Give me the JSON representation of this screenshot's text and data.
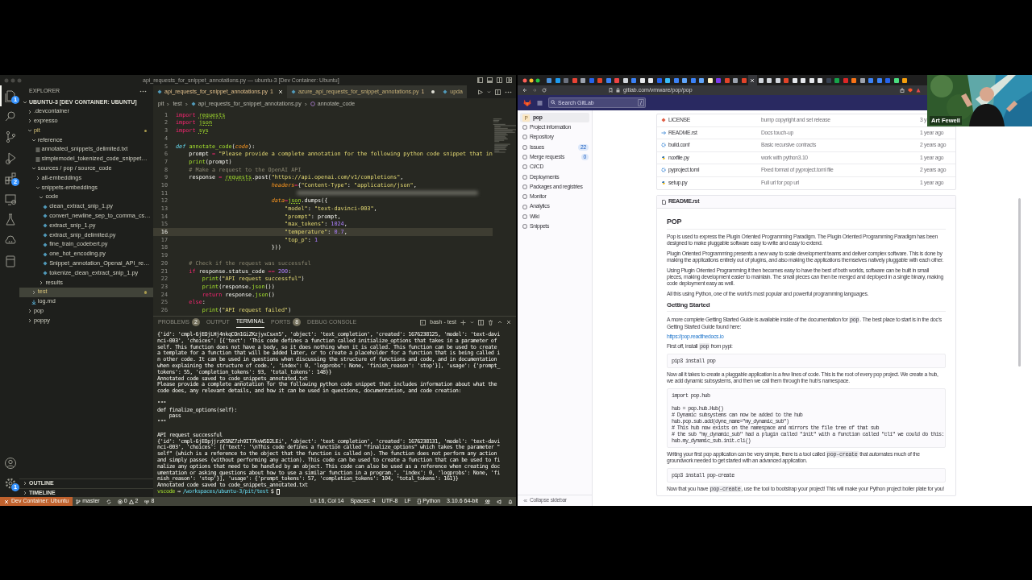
{
  "vscode": {
    "title": "api_requests_for_snippet_annotations.py — ubuntu-3 [Dev Container: Ubuntu]",
    "activity_bar": [
      {
        "kind": "explorer",
        "badge": "1",
        "selected": true
      },
      {
        "kind": "search",
        "selected": false
      },
      {
        "kind": "source_control",
        "selected": false
      },
      {
        "kind": "run_debug",
        "selected": false
      },
      {
        "kind": "extensions",
        "badge": "2",
        "selected": false
      },
      {
        "kind": "remote",
        "selected": false
      },
      {
        "kind": "testing",
        "selected": false
      },
      {
        "kind": "extension_a",
        "selected": false
      },
      {
        "kind": "extension_b",
        "selected": false
      }
    ],
    "activity_bottom": [
      {
        "kind": "accounts"
      },
      {
        "kind": "manage",
        "badge": "1"
      }
    ],
    "explorer": {
      "title": "EXPLORER",
      "root": "UBUNTU-3 [DEV CONTAINER: UBUNTU]",
      "tree": [
        {
          "label": ".devcontainer",
          "kind": "folder",
          "expanded": false,
          "modified": false,
          "selected": false
        },
        {
          "label": "expresso",
          "kind": "folder",
          "expanded": false,
          "modified": false,
          "selected": false
        },
        {
          "label": "pit",
          "kind": "folder",
          "expanded": true,
          "modified": true,
          "selected": false,
          "children": [
            {
              "label": "reference",
              "kind": "folder",
              "expanded": true,
              "modified": false,
              "selected": false,
              "children": [
                {
                  "label": "annotated_snippets_delimited.txt",
                  "kind": "text",
                  "modified": false,
                  "selected": false
                },
                {
                  "label": "simplemodel_tokenized_code_snippet…",
                  "kind": "text",
                  "modified": false,
                  "selected": false
                }
              ]
            },
            {
              "label": "sources / pop / source_code",
              "kind": "folder",
              "expanded": true,
              "modified": false,
              "selected": false,
              "children": [
                {
                  "label": "all-embeddings",
                  "kind": "folder",
                  "expanded": false,
                  "modified": false,
                  "selected": false
                },
                {
                  "label": "snippets-embeddings",
                  "kind": "folder",
                  "expanded": true,
                  "modified": false,
                  "selected": false,
                  "children": [
                    {
                      "label": "code",
                      "kind": "folder",
                      "expanded": true,
                      "modified": false,
                      "selected": false,
                      "children": [
                        {
                          "label": "clean_extract_snip_1.py",
                          "kind": "python",
                          "modified": false,
                          "selected": false
                        },
                        {
                          "label": "convert_newline_sep_to_comma_cs…",
                          "kind": "python",
                          "modified": false,
                          "selected": false
                        },
                        {
                          "label": "extract_snip_1.py",
                          "kind": "python",
                          "modified": false,
                          "selected": false
                        },
                        {
                          "label": "extract_snip_delimited.py",
                          "kind": "python",
                          "modified": false,
                          "selected": false
                        },
                        {
                          "label": "fine_train_codebert.py",
                          "kind": "python",
                          "modified": false,
                          "selected": false
                        },
                        {
                          "label": "one_hot_encoding.py",
                          "kind": "python",
                          "modified": false,
                          "selected": false
                        },
                        {
                          "label": "Snippet_annotation_Openai_API_re…",
                          "kind": "python",
                          "modified": false,
                          "selected": false
                        },
                        {
                          "label": "tokenize_clean_extract_snip_1.py",
                          "kind": "python",
                          "modified": false,
                          "selected": false
                        }
                      ]
                    },
                    {
                      "label": "results",
                      "kind": "folder",
                      "expanded": false,
                      "modified": false,
                      "selected": false
                    }
                  ]
                }
              ]
            },
            {
              "label": "test",
              "kind": "folder",
              "expanded": false,
              "modified": true,
              "selected": true
            },
            {
              "label": "log.md",
              "kind": "markdown",
              "modified": false,
              "selected": false
            }
          ]
        },
        {
          "label": "pop",
          "kind": "folder",
          "expanded": false,
          "modified": false,
          "selected": false
        },
        {
          "label": "poppy",
          "kind": "folder",
          "expanded": false,
          "modified": false,
          "selected": false
        }
      ],
      "sections": [
        "OUTLINE",
        "TIMELINE"
      ]
    },
    "editor": {
      "tabs": [
        {
          "label": "api_requests_for_snippet_annotations.py",
          "problems": "1",
          "modified": false,
          "selected": true
        },
        {
          "label": "azure_api_requests_for_snippet_annotations.py",
          "problems": "1",
          "modified": true,
          "selected": false
        },
        {
          "label": "upda",
          "modified": false,
          "selected": false
        }
      ],
      "breadcrumb": [
        "pit",
        "test",
        "api_requests_for_snippet_annotations.py",
        "annotate_code"
      ],
      "lines": [
        {
          "number": "1",
          "current": false,
          "segments": [
            {
              "text": "import ",
              "kind": "keyword"
            },
            {
              "text": "requests",
              "kind": "module"
            }
          ]
        },
        {
          "number": "2",
          "current": false,
          "segments": [
            {
              "text": "import ",
              "kind": "keyword"
            },
            {
              "text": "json",
              "kind": "module"
            }
          ]
        },
        {
          "number": "3",
          "current": false,
          "segments": [
            {
              "text": "import ",
              "kind": "keyword"
            },
            {
              "text": "sys",
              "kind": "module"
            }
          ]
        },
        {
          "number": "4",
          "current": false
        },
        {
          "number": "5",
          "current": false,
          "segments": [
            {
              "text": "def ",
              "kind": "def"
            },
            {
              "text": "annotate_code",
              "kind": "function"
            },
            {
              "text": "(",
              "kind": "plain"
            },
            {
              "text": "code",
              "kind": "param"
            },
            {
              "text": "):",
              "kind": "plain"
            }
          ]
        },
        {
          "number": "6",
          "current": false,
          "segments": [
            {
              "text": "    prompt ",
              "kind": "plain"
            },
            {
              "text": "= ",
              "kind": "operator"
            },
            {
              "text": "\"Please provide a complete annotation for the following python code snippet that in",
              "kind": "string"
            }
          ]
        },
        {
          "number": "7",
          "current": false,
          "segments": [
            {
              "text": "    print",
              "kind": "function"
            },
            {
              "text": "(prompt)",
              "kind": "plain"
            }
          ]
        },
        {
          "number": "8",
          "current": false,
          "segments": [
            {
              "text": "    # Make a request to the OpenAI API",
              "kind": "comment"
            }
          ]
        },
        {
          "number": "9",
          "current": false,
          "segments": [
            {
              "text": "    response ",
              "kind": "plain"
            },
            {
              "text": "= ",
              "kind": "operator"
            },
            {
              "text": "requests",
              "kind": "module"
            },
            {
              "text": ".post(",
              "kind": "plain"
            },
            {
              "text": "\"https://api.openai.com/v1/completions\"",
              "kind": "string"
            },
            {
              "text": ",",
              "kind": "plain"
            }
          ]
        },
        {
          "number": "10",
          "current": false,
          "segments": [
            {
              "text": "                             headers",
              "kind": "param"
            },
            {
              "text": "=",
              "kind": "operator"
            },
            {
              "text": "{",
              "kind": "plain"
            },
            {
              "text": "\"Content-Type\"",
              "kind": "string"
            },
            {
              "text": ": ",
              "kind": "plain"
            },
            {
              "text": "\"application/json\"",
              "kind": "string"
            },
            {
              "text": ",",
              "kind": "plain"
            }
          ]
        },
        {
          "number": "11",
          "current": false,
          "redacted": true
        },
        {
          "number": "12",
          "current": false,
          "segments": [
            {
              "text": "                             data",
              "kind": "param"
            },
            {
              "text": "=",
              "kind": "operator"
            },
            {
              "text": "json",
              "kind": "module"
            },
            {
              "text": ".dumps({",
              "kind": "plain"
            }
          ]
        },
        {
          "number": "13",
          "current": false,
          "segments": [
            {
              "text": "                                 \"model\"",
              "kind": "string"
            },
            {
              "text": ": ",
              "kind": "plain"
            },
            {
              "text": "\"text-davinci-003\"",
              "kind": "string"
            },
            {
              "text": ",",
              "kind": "plain"
            }
          ]
        },
        {
          "number": "14",
          "current": false,
          "segments": [
            {
              "text": "                                 \"prompt\"",
              "kind": "string"
            },
            {
              "text": ": prompt,",
              "kind": "plain"
            }
          ]
        },
        {
          "number": "15",
          "current": false,
          "segments": [
            {
              "text": "                                 \"max_tokens\"",
              "kind": "string"
            },
            {
              "text": ": ",
              "kind": "plain"
            },
            {
              "text": "1024",
              "kind": "number"
            },
            {
              "text": ",",
              "kind": "plain"
            }
          ]
        },
        {
          "number": "16",
          "current": true,
          "segments": [
            {
              "text": "                                 \"temperature\"",
              "kind": "string"
            },
            {
              "text": ": ",
              "kind": "plain"
            },
            {
              "text": "0.7",
              "kind": "number"
            },
            {
              "text": ",",
              "kind": "plain"
            }
          ]
        },
        {
          "number": "17",
          "current": false,
          "segments": [
            {
              "text": "                                 \"top_p\"",
              "kind": "string"
            },
            {
              "text": ": ",
              "kind": "plain"
            },
            {
              "text": "1",
              "kind": "number"
            }
          ]
        },
        {
          "number": "18",
          "current": false,
          "segments": [
            {
              "text": "                             }))",
              "kind": "plain"
            }
          ]
        },
        {
          "number": "19",
          "current": false
        },
        {
          "number": "20",
          "current": false,
          "segments": [
            {
              "text": "    # Check if the request was successful",
              "kind": "comment"
            }
          ]
        },
        {
          "number": "21",
          "current": false,
          "segments": [
            {
              "text": "    if",
              "kind": "keyword"
            },
            {
              "text": " response.status_code ",
              "kind": "plain"
            },
            {
              "text": "== ",
              "kind": "operator"
            },
            {
              "text": "200",
              "kind": "number"
            },
            {
              "text": ":",
              "kind": "plain"
            }
          ]
        },
        {
          "number": "22",
          "current": false,
          "segments": [
            {
              "text": "        print",
              "kind": "function"
            },
            {
              "text": "(",
              "kind": "plain"
            },
            {
              "text": "\"API request successful\"",
              "kind": "string"
            },
            {
              "text": ")",
              "kind": "plain"
            }
          ]
        },
        {
          "number": "23",
          "current": false,
          "segments": [
            {
              "text": "        print",
              "kind": "function"
            },
            {
              "text": "(response.",
              "kind": "plain"
            },
            {
              "text": "json",
              "kind": "function"
            },
            {
              "text": "())",
              "kind": "plain"
            }
          ]
        },
        {
          "number": "24",
          "current": false,
          "segments": [
            {
              "text": "        return",
              "kind": "keyword"
            },
            {
              "text": " response.",
              "kind": "plain"
            },
            {
              "text": "json",
              "kind": "function"
            },
            {
              "text": "()",
              "kind": "plain"
            }
          ]
        },
        {
          "number": "25",
          "current": false,
          "segments": [
            {
              "text": "    else",
              "kind": "keyword"
            },
            {
              "text": ":",
              "kind": "plain"
            }
          ]
        },
        {
          "number": "26",
          "current": false,
          "segments": [
            {
              "text": "        print",
              "kind": "function"
            },
            {
              "text": "(",
              "kind": "plain"
            },
            {
              "text": "\"API request failed\"",
              "kind": "string"
            },
            {
              "text": ")",
              "kind": "plain"
            }
          ]
        }
      ]
    },
    "panel": {
      "tabs": [
        {
          "label": "PROBLEMS",
          "count": "2",
          "selected": false
        },
        {
          "label": "OUTPUT",
          "selected": false
        },
        {
          "label": "TERMINAL",
          "selected": true
        },
        {
          "label": "PORTS",
          "count": "8",
          "selected": false
        },
        {
          "label": "DEBUG CONSOLE",
          "selected": false
        }
      ],
      "terminal_name": "bash - test",
      "groups": [
        [
          "{'id': 'cmpl-6jEOjLHj4nkqCOn1GiZKzjyxCsxn5', 'object': 'text_completion', 'created': 1676238125, 'model': 'text-davi",
          "nci-003', 'choices': [{'text': 'This code defines a function called initialize_options that takes in a parameter of",
          "self. This function does not have a body, so it does nothing when it is called. This function can be used to create",
          "a template for a function that will be added later, or to create a placeholder for a function that is being called i",
          "n other code. It can be used in questions when discussing the structure of functions and code, and in documentation",
          "when explaining the structure of code.', 'index': 0, 'logprobs': None, 'finish_reason': 'stop'}], 'usage': {'prompt_",
          "tokens': 55, 'completion_tokens': 93, 'total_tokens': 148}}",
          "Annotated code saved to code_snippets_annotated.txt",
          "Please provide a complete annotation for the following python code snippet that includes information about what the",
          "code does, any relevant details, and how it can be used in questions, documentation, and code creation:"
        ],
        [
          "\"\"\"",
          "def finalize_options(self):",
          "    pass",
          "\"\"\""
        ],
        [
          "API request successful",
          "{'id': 'cmpl-6jEOpjjrzKSNZ7zh9IT7kvW5D2LEi', 'object': 'text_completion', 'created': 1676238131, 'model': 'text-davi",
          "nci-003', 'choices': [{'text': '\\nThis code defines a function called \"finalize_options\" which takes the parameter \"",
          "self\" (which is a reference to the object that the function is called on). The function does not perform any action",
          "and simply passes (without performing any action). This code can be used to create a function that can be used to fi",
          "nalize any options that need to be handled by an object. This code can also be used as a reference when creating doc",
          "umentation or asking questions about how to use a similar function in a program.', 'index': 0, 'logprobs': None, 'fi",
          "nish_reason': 'stop'}], 'usage': {'prompt_tokens': 57, 'completion_tokens': 104, 'total_tokens': 161}}",
          "Annotated code saved to code_snippets_annotated.txt"
        ]
      ],
      "prompt": {
        "user": "vscode",
        "arrow": "→",
        "path": "/workspaces/ubuntu-3/pit/test",
        "symbol": "$"
      }
    },
    "status_bar": {
      "remote": "Dev Container: Ubuntu",
      "branch": "master",
      "errors": "0",
      "warnings": "2",
      "ports": "8",
      "position": "Ln 16, Col 14",
      "indent": "Spaces: 4",
      "encoding": "UTF-8",
      "eol": "LF",
      "language_badge": "{}",
      "language": "Python",
      "interpreter": "3.10.6 64-bit"
    }
  },
  "browser": {
    "tabs": [
      {
        "color": "#4a90d9",
        "selected": false
      },
      {
        "color": "#1d9bf0",
        "selected": false
      },
      {
        "color": "#6b7280",
        "selected": false
      },
      {
        "color": "#ea4335",
        "selected": false
      },
      {
        "color": "#9ca3af",
        "selected": false
      },
      {
        "color": "#2563eb",
        "selected": false
      },
      {
        "color": "#e24329",
        "selected": false
      },
      {
        "color": "#3b82f6",
        "selected": false
      },
      {
        "color": "#ef4444",
        "selected": false
      },
      {
        "color": "#d1d5db",
        "selected": false
      },
      {
        "color": "#3b82f6",
        "selected": false
      },
      {
        "color": "#e5e7eb",
        "selected": false
      },
      {
        "color": "#e5e7eb",
        "selected": false
      },
      {
        "color": "#2563eb",
        "selected": false
      },
      {
        "color": "#38bdf8",
        "selected": false
      },
      {
        "color": "#3b82f6",
        "selected": false
      },
      {
        "color": "#60a5fa",
        "selected": false
      },
      {
        "color": "#3b82f6",
        "selected": false
      },
      {
        "color": "#60a5fa",
        "selected": false
      },
      {
        "color": "#fef3c7",
        "selected": false
      },
      {
        "color": "#7c3aed",
        "selected": false
      },
      {
        "color": "#e24329",
        "selected": false
      },
      {
        "color": "#9ca3af",
        "selected": false
      },
      {
        "color": "#e24329",
        "selected": false
      },
      {
        "selected": true
      },
      {
        "color": "#d1d5db",
        "selected": false
      },
      {
        "color": "#d1d5db",
        "selected": false
      },
      {
        "color": "#d1d5db",
        "selected": false
      },
      {
        "color": "#e24329",
        "selected": false
      },
      {
        "color": "#e5e7eb",
        "selected": false
      },
      {
        "color": "#e5e7eb",
        "selected": false
      },
      {
        "color": "#e5e7eb",
        "selected": false
      },
      {
        "color": "#e5e7eb",
        "selected": false
      },
      {
        "color": "#374151",
        "selected": false
      },
      {
        "color": "#16a34a",
        "selected": false
      },
      {
        "color": "#dc2626",
        "selected": false
      },
      {
        "color": "#f97316",
        "selected": false
      },
      {
        "color": "#9ca3af",
        "selected": false
      },
      {
        "color": "#3b82f6",
        "selected": false
      },
      {
        "color": "#3b82f6",
        "selected": false
      },
      {
        "color": "#2563eb",
        "selected": false
      },
      {
        "color": "#4ade80",
        "selected": false
      },
      {
        "color": "#f59e0b",
        "selected": false
      }
    ],
    "address": "gitlab.com/vmware/pop/pop",
    "gitlab": {
      "search": {
        "placeholder": "Search GitLab",
        "shortcut": "/"
      },
      "project": {
        "avatar": "P",
        "name": "pop"
      },
      "nav": [
        {
          "label": "Project information"
        },
        {
          "label": "Repository"
        },
        {
          "label": "Issues",
          "count": "22"
        },
        {
          "label": "Merge requests",
          "count": "0"
        },
        {
          "label": "CI/CD"
        },
        {
          "label": "Deployments"
        },
        {
          "label": "Packages and registries"
        },
        {
          "label": "Monitor"
        },
        {
          "label": "Analytics"
        },
        {
          "label": "Wiki"
        },
        {
          "label": "Snippets"
        }
      ],
      "collapse": "Collapse sidebar",
      "files": [
        {
          "name": "LICENSE",
          "kind": "license",
          "commit": "bump copyright and set release",
          "date": "3 y"
        },
        {
          "name": "README.rst",
          "kind": "doc",
          "commit": "Docs touch-up",
          "date": "1 year ago"
        },
        {
          "name": "build.conf",
          "kind": "config",
          "commit": "Basic recursive contracts",
          "date": "2 years ago"
        },
        {
          "name": "noxfile.py",
          "kind": "python",
          "commit": "work with python3.10",
          "date": "1 year ago"
        },
        {
          "name": "pyproject.toml",
          "kind": "config",
          "commit": "Fixed format of pyproject.toml file",
          "date": "2 years ago"
        },
        {
          "name": "setup.py",
          "kind": "python",
          "commit": "Full url for pop url",
          "date": "1 year ago"
        }
      ],
      "readme": {
        "filename": "README.rst",
        "blocks": [
          {
            "kind": "h1",
            "text": "POP"
          },
          {
            "kind": "p",
            "parts": [
              {
                "kind": "text",
                "text": "Pop is used to express the Plugin Oriented Programming Paradigm. The Plugin Oriented Programming Paradigm has been designed to make pluggable software easy to write and easy to extend."
              }
            ]
          },
          {
            "kind": "p",
            "parts": [
              {
                "kind": "text",
                "text": "Plugin Oriented Programming presents a new way to scale development teams and deliver complex software. This is done by making the applications entirely out of plugins, and also making the applications themselves natively pluggable with each other."
              }
            ]
          },
          {
            "kind": "p",
            "parts": [
              {
                "kind": "text",
                "text": "Using Plugin Oriented Programming it then becomes easy to have the best of both worlds, software can be built in small pieces, making development easier to maintain. The small pieces can then be merged and deployed in a single binary, making code deployment easy as well."
              }
            ]
          },
          {
            "kind": "p",
            "parts": [
              {
                "kind": "text",
                "text": "All this using Python, one of the world's most popular and powerful programming languages."
              }
            ]
          },
          {
            "kind": "h2",
            "text": "Getting Started"
          },
          {
            "kind": "p",
            "parts": [
              {
                "kind": "text",
                "text": "A more complete Getting Started Guide is available inside of the documentation for "
              },
              {
                "kind": "code",
                "text": "pop"
              },
              {
                "kind": "text",
                "text": ". The best place to start is in the doc's Getting Started Guide found here:"
              }
            ]
          },
          {
            "kind": "link",
            "text": "https://pop.readthedocs.io"
          },
          {
            "kind": "p",
            "parts": [
              {
                "kind": "text",
                "text": "First off, install "
              },
              {
                "kind": "code",
                "text": "pop"
              },
              {
                "kind": "text",
                "text": " from pypi:"
              }
            ]
          },
          {
            "kind": "code",
            "groups": [
              [
                "pip3 install pop"
              ]
            ]
          },
          {
            "kind": "p",
            "parts": [
              {
                "kind": "text",
                "text": "Now all it takes to create a pluggable application is a few lines of code. This is the root of every pop project. We create a hub, we add dynamic subsystems, and then we call them through the hub's namespace."
              }
            ]
          },
          {
            "kind": "code",
            "groups": [
              [
                "import pop.hub"
              ],
              [
                "hub = pop.hub.Hub()",
                "# Dynamic subsystems can now be added to the hub",
                "hub.pop.sub.add(dyne_name=\"my_dynamic_sub\")",
                "# This hub now exists on the namespace and mirrors the file tree of that sub",
                "# the sub \"my_dynamic_sub\" had a plugin called \"init\" with a function called \"cli\" we could do this:",
                "hub.my_dynamic_sub.init.cli()"
              ]
            ]
          },
          {
            "kind": "p",
            "parts": [
              {
                "kind": "text",
                "text": "Writing your first pop application can be very simple, there is a tool called "
              },
              {
                "kind": "code",
                "text": "pop-create"
              },
              {
                "kind": "text",
                "text": " that automates much of the groundwork needed to get started with an advanced application."
              }
            ]
          },
          {
            "kind": "code",
            "groups": [
              [
                "pip3 install pop-create"
              ]
            ]
          },
          {
            "kind": "p",
            "parts": [
              {
                "kind": "text",
                "text": "Now that you have "
              },
              {
                "kind": "code",
                "text": "pop-create"
              },
              {
                "kind": "text",
                "text": ", use the tool to bootstrap your project! This will make your Python project boiler plate for you!"
              }
            ]
          }
        ]
      }
    },
    "webcam": {
      "name": "Art Fewell"
    }
  }
}
